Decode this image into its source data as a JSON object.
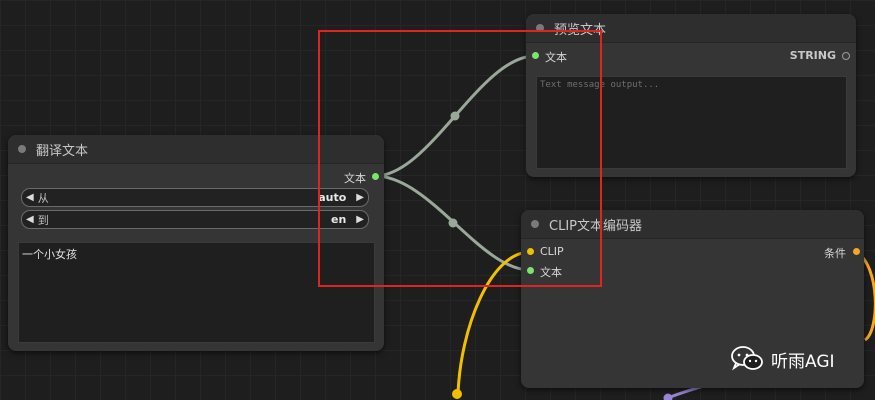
{
  "colors": {
    "background": "#1e1e1e",
    "node": "#353535",
    "wire_text": "#9aa89a",
    "wire_clip": "#f0c000",
    "wire_cond": "#9a86d6",
    "slot_green": "#7ae56a",
    "slot_yellow": "#f0c000",
    "slot_orange": "#f5a623",
    "highlight": "#e0251f"
  },
  "translate_node": {
    "title": "翻译文本",
    "output_label": "文本",
    "from_label": "从",
    "from_value": "auto",
    "to_label": "到",
    "to_value": "en",
    "text_value": "一个小女孩"
  },
  "preview_node": {
    "title": "预览文本",
    "input_label": "文本",
    "output_label": "STRING",
    "placeholder": "Text message output..."
  },
  "clip_node": {
    "title": "CLIP文本编码器",
    "input_clip_label": "CLIP",
    "input_text_label": "文本",
    "output_label": "条件"
  },
  "watermark": {
    "text": "听雨AGI",
    "icon": "wechat-icon"
  }
}
